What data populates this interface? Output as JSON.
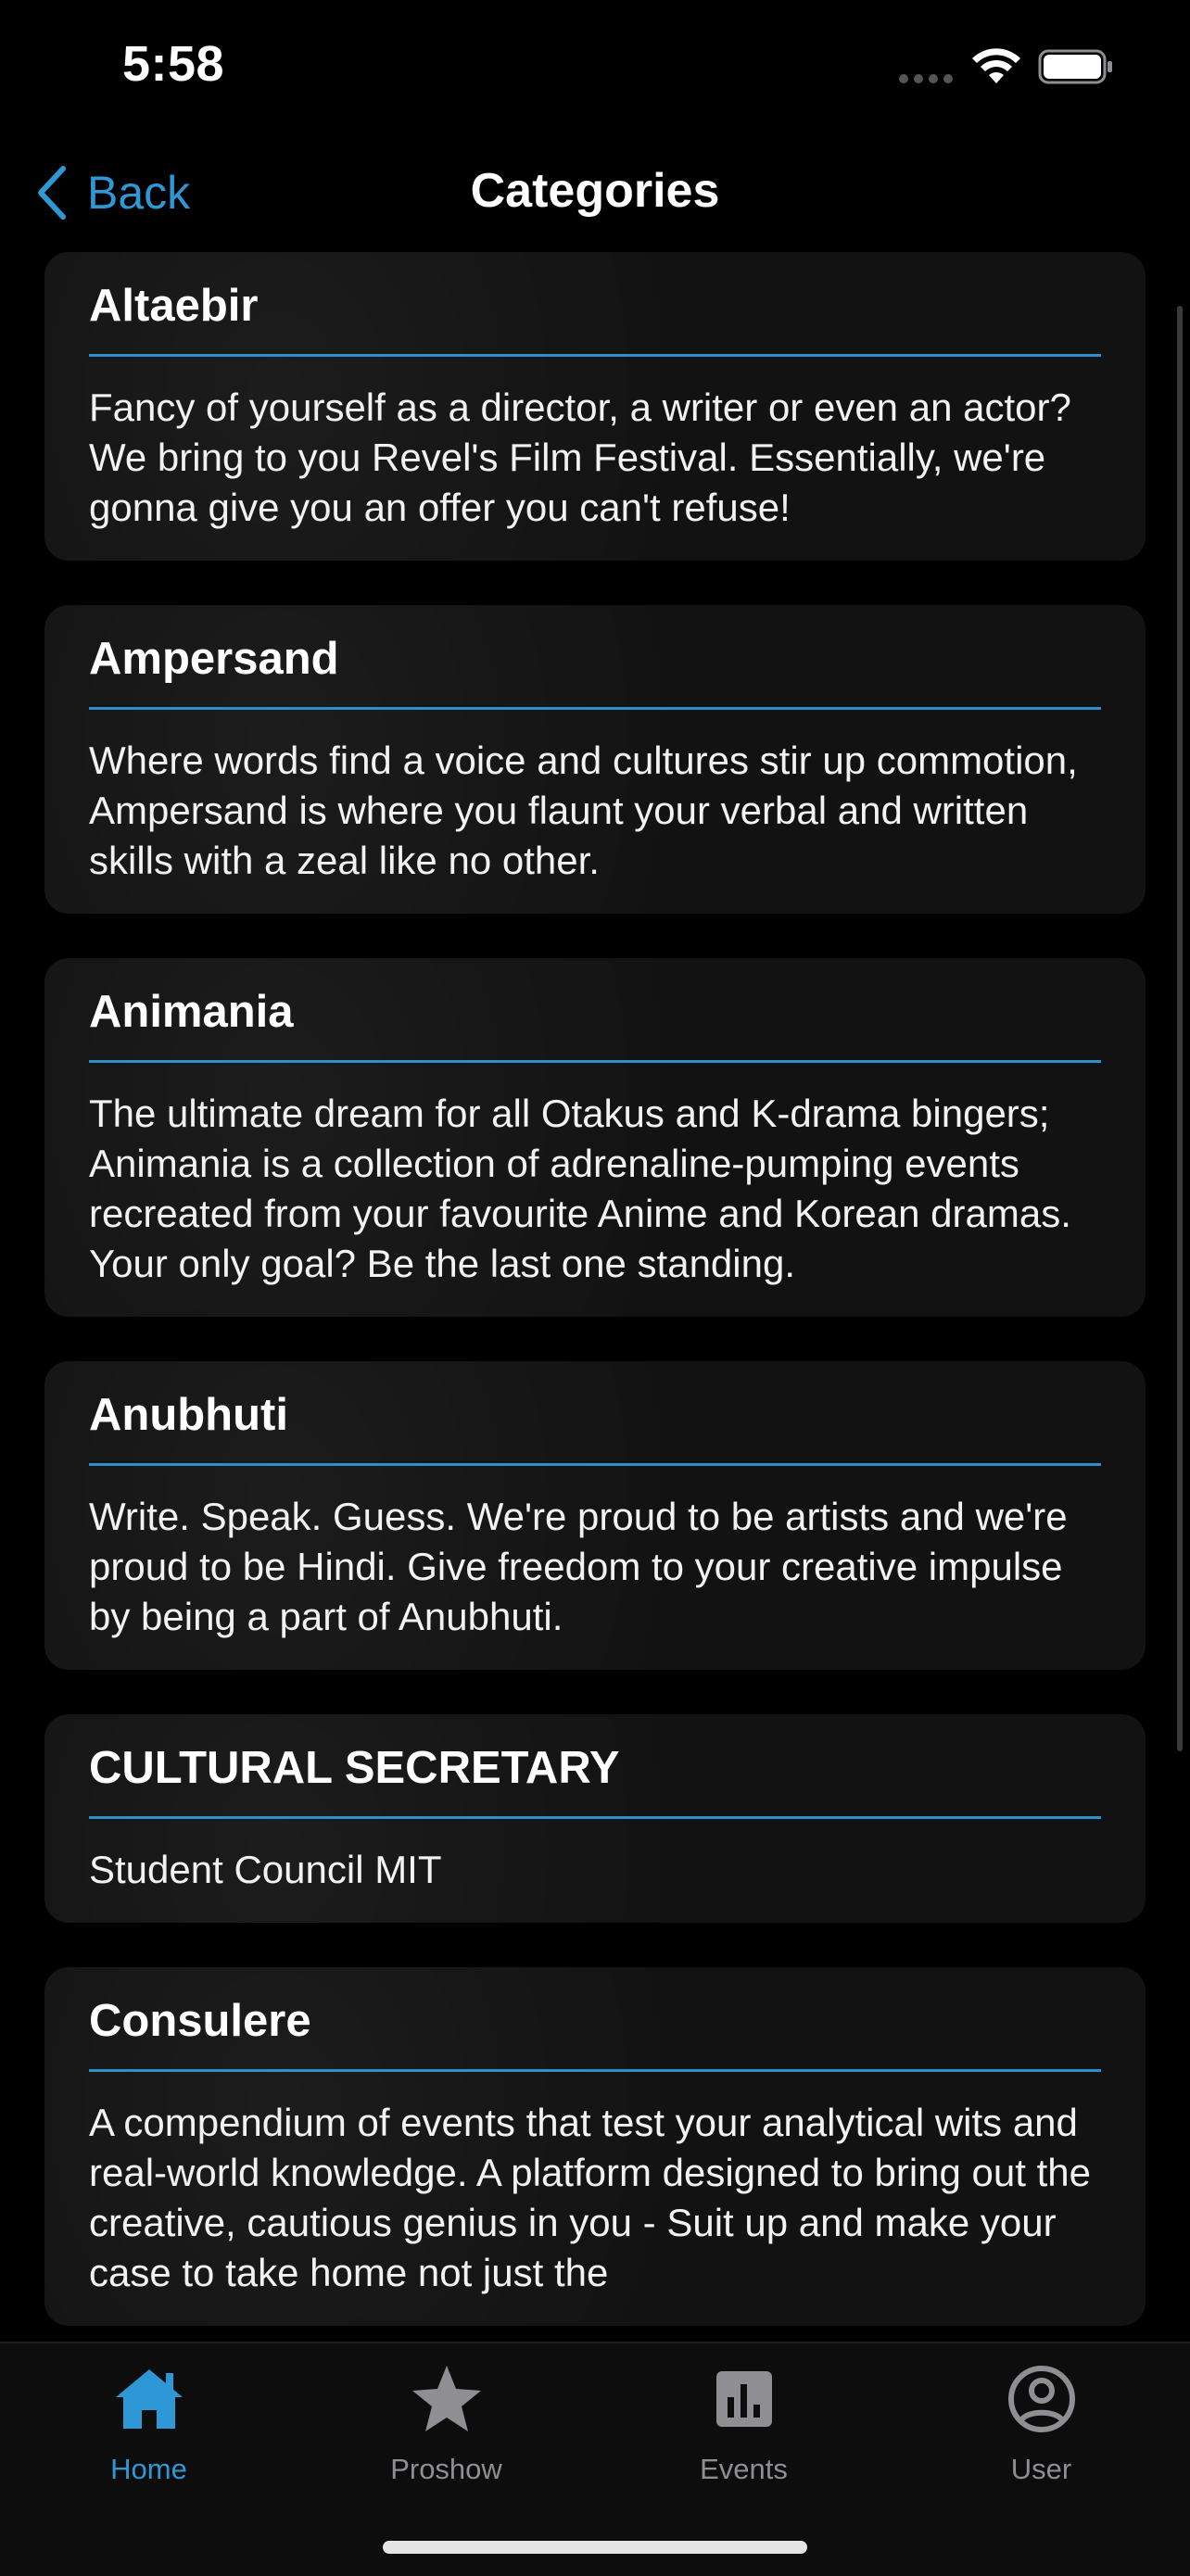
{
  "status_bar": {
    "time": "5:58"
  },
  "nav": {
    "back_label": "Back",
    "title": "Categories"
  },
  "categories": [
    {
      "title": "Altaebir",
      "description": "Fancy of yourself as a director, a writer or even an actor? We bring to you Revel's Film Festival. Essentially, we're gonna give you an offer you can't refuse!"
    },
    {
      "title": "Ampersand",
      "description": "Where words find a voice and cultures stir up commotion, Ampersand is where you flaunt your verbal and written skills with a zeal like no other."
    },
    {
      "title": "Animania",
      "description": "The ultimate dream for all Otakus and K-drama bingers; Animania is a collection of adrenaline-pumping events recreated from your favourite Anime and Korean dramas. Your only goal? Be the last one standing."
    },
    {
      "title": "Anubhuti",
      "description": "Write. Speak. Guess. We're proud to be artists and we're proud to be Hindi. Give freedom to your creative impulse by being a part of Anubhuti."
    },
    {
      "title": "CULTURAL SECRETARY",
      "description": "Student Council MIT"
    },
    {
      "title": "Consulere",
      "description": "A compendium of events that test your analytical wits and real-world knowledge. A platform designed to bring out the creative, cautious genius in you - Suit up and make your case to take home not just the"
    }
  ],
  "tabs": [
    {
      "label": "Home",
      "icon": "house-icon",
      "active": true
    },
    {
      "label": "Proshow",
      "icon": "star-icon",
      "active": false
    },
    {
      "label": "Events",
      "icon": "bar-chart-icon",
      "active": false
    },
    {
      "label": "User",
      "icon": "user-circle-icon",
      "active": false
    }
  ],
  "colors": {
    "accent": "#2e98d6",
    "card_background": "#121212",
    "inactive_tab": "#8e8e93",
    "divider": "#2e8fcf"
  }
}
